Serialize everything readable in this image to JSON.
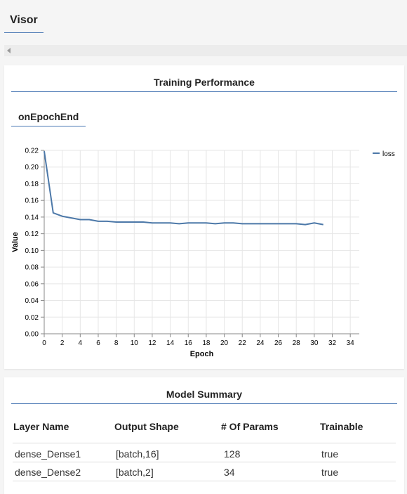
{
  "app": {
    "title": "Visor"
  },
  "training": {
    "title": "Training Performance",
    "tab": "onEpochEnd"
  },
  "chart_data": {
    "type": "line",
    "xlabel": "Epoch",
    "ylabel": "Value",
    "xlim": [
      0,
      35
    ],
    "ylim": [
      0,
      0.22
    ],
    "x_ticks": [
      0,
      2,
      4,
      6,
      8,
      10,
      12,
      14,
      16,
      18,
      20,
      22,
      24,
      26,
      28,
      30,
      32,
      34
    ],
    "y_ticks": [
      0.0,
      0.02,
      0.04,
      0.06,
      0.08,
      0.1,
      0.12,
      0.14,
      0.16,
      0.18,
      0.2,
      0.22
    ],
    "grid": true,
    "legend_position": "top-right",
    "series": [
      {
        "name": "loss",
        "color": "#4c78a8",
        "x": [
          0,
          1,
          2,
          3,
          4,
          5,
          6,
          7,
          8,
          9,
          10,
          11,
          12,
          13,
          14,
          15,
          16,
          17,
          18,
          19,
          20,
          21,
          22,
          23,
          24,
          25,
          26,
          27,
          28,
          29,
          30,
          31
        ],
        "y": [
          0.219,
          0.145,
          0.141,
          0.139,
          0.137,
          0.137,
          0.135,
          0.135,
          0.134,
          0.134,
          0.134,
          0.134,
          0.133,
          0.133,
          0.133,
          0.132,
          0.133,
          0.133,
          0.133,
          0.132,
          0.133,
          0.133,
          0.132,
          0.132,
          0.132,
          0.132,
          0.132,
          0.132,
          0.132,
          0.131,
          0.133,
          0.131
        ]
      }
    ]
  },
  "model_summary": {
    "title": "Model Summary",
    "headers": [
      "Layer Name",
      "Output Shape",
      "# Of Params",
      "Trainable"
    ],
    "rows": [
      [
        "dense_Dense1",
        "[batch,16]",
        "128",
        "true"
      ],
      [
        "dense_Dense2",
        "[batch,2]",
        "34",
        "true"
      ]
    ]
  }
}
